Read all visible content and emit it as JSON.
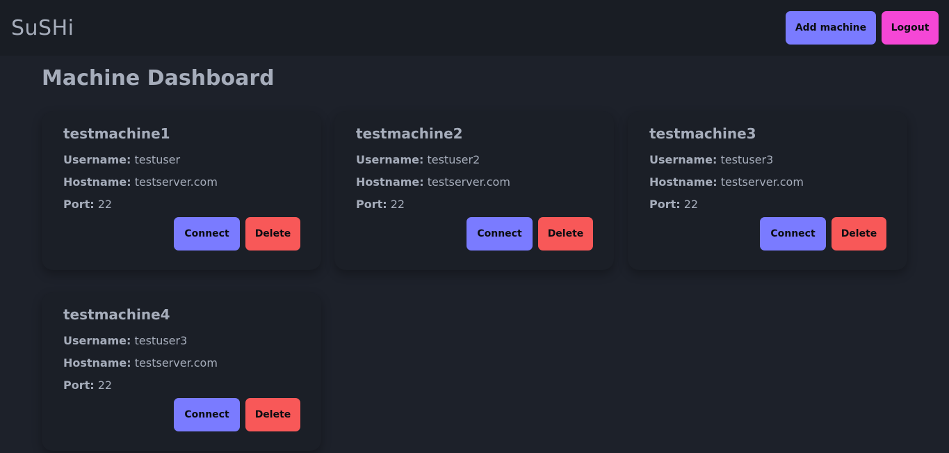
{
  "navbar": {
    "brand": "SuSHi",
    "add_machine_label": "Add machine",
    "logout_label": "Logout"
  },
  "page": {
    "title": "Machine Dashboard"
  },
  "labels": {
    "username": "Username:",
    "hostname": "Hostname:",
    "port": "Port:",
    "connect": "Connect",
    "delete": "Delete"
  },
  "machines": [
    {
      "name": "testmachine1",
      "username": "testuser",
      "hostname": "testserver.com",
      "port": "22"
    },
    {
      "name": "testmachine2",
      "username": "testuser2",
      "hostname": "testserver.com",
      "port": "22"
    },
    {
      "name": "testmachine3",
      "username": "testuser3",
      "hostname": "testserver.com",
      "port": "22"
    },
    {
      "name": "testmachine4",
      "username": "testuser3",
      "hostname": "testserver.com",
      "port": "22"
    }
  ],
  "colors": {
    "background": "#1d212a",
    "navbar": "#191d24",
    "primary": "#7a7bff",
    "secondary": "#f547d6",
    "error": "#f85858"
  }
}
